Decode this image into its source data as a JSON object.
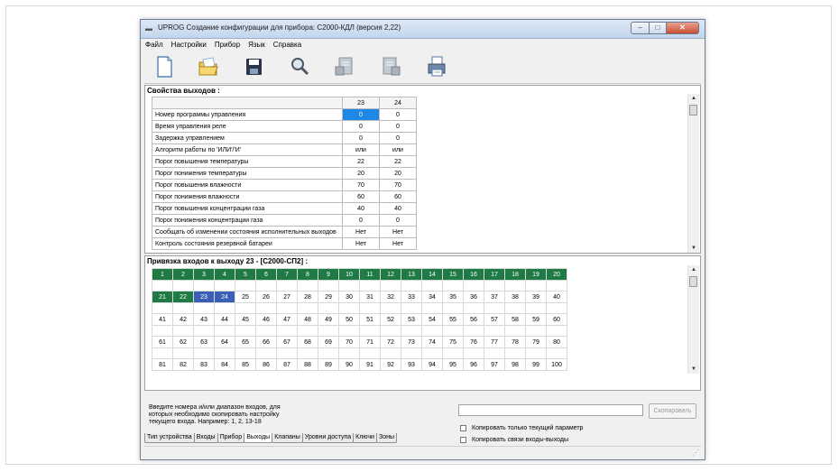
{
  "window": {
    "title": "UPROG  Создание конфигурации для прибора: С2000-КДЛ (версия  2,22)",
    "controls": {
      "minimize": "–",
      "maximize": "□",
      "close": "✕"
    }
  },
  "menu": [
    "Файл",
    "Настройки",
    "Прибор",
    "Язык",
    "Справка"
  ],
  "toolbar": {
    "buttons": [
      "new-file-icon",
      "open-folder-icon",
      "save-icon",
      "search-icon",
      "read-device-icon",
      "write-device-icon",
      "print-icon"
    ]
  },
  "outputs": {
    "header": "Свойства выходов :",
    "columns": [
      "23",
      "24"
    ],
    "rows": [
      {
        "name": "Номер программы управления",
        "v23": "0",
        "v24": "0"
      },
      {
        "name": "Время управления реле",
        "v23": "0",
        "v24": "0"
      },
      {
        "name": "Задержка управлением",
        "v23": "0",
        "v24": "0"
      },
      {
        "name": "Алгоритм работы по 'ИЛИ'/'И'",
        "v23": "или",
        "v24": "или"
      },
      {
        "name": "Порог повышения температуры",
        "v23": "22",
        "v24": "22"
      },
      {
        "name": "Порог понижения температуры",
        "v23": "20",
        "v24": "20"
      },
      {
        "name": "Порог повышения влажности",
        "v23": "70",
        "v24": "70"
      },
      {
        "name": "Порог понижения влажности",
        "v23": "60",
        "v24": "60"
      },
      {
        "name": "Порог повышения концентрации газа",
        "v23": "40",
        "v24": "40"
      },
      {
        "name": "Порог понижения концентрации газа",
        "v23": "0",
        "v24": "0"
      },
      {
        "name": "Сообщать об изменении состояния исполнительных выходов",
        "v23": "Нет",
        "v24": "Нет"
      },
      {
        "name": "Контроль состояния резервной батареи",
        "v23": "Нет",
        "v24": "Нет"
      }
    ]
  },
  "bindings": {
    "header": "Привязка входов к выходу 23 - [С2000-СП2] :",
    "rows": [
      [
        "1",
        "2",
        "3",
        "4",
        "5",
        "6",
        "7",
        "8",
        "9",
        "10",
        "11",
        "12",
        "13",
        "14",
        "15",
        "16",
        "17",
        "18",
        "19",
        "20"
      ],
      [
        "21",
        "22",
        "23",
        "24",
        "25",
        "26",
        "27",
        "28",
        "29",
        "30",
        "31",
        "32",
        "33",
        "34",
        "35",
        "36",
        "37",
        "38",
        "39",
        "40"
      ],
      [
        "41",
        "42",
        "43",
        "44",
        "45",
        "46",
        "47",
        "48",
        "49",
        "50",
        "51",
        "52",
        "53",
        "54",
        "55",
        "56",
        "57",
        "58",
        "59",
        "60"
      ],
      [
        "61",
        "62",
        "63",
        "64",
        "65",
        "66",
        "67",
        "68",
        "69",
        "70",
        "71",
        "72",
        "73",
        "74",
        "75",
        "76",
        "77",
        "78",
        "79",
        "80"
      ],
      [
        "81",
        "82",
        "83",
        "84",
        "85",
        "86",
        "87",
        "88",
        "89",
        "90",
        "91",
        "92",
        "93",
        "94",
        "95",
        "96",
        "97",
        "98",
        "99",
        "100"
      ]
    ],
    "highlight_green": [
      "1",
      "2",
      "3",
      "4",
      "5",
      "6",
      "7",
      "8",
      "9",
      "10",
      "11",
      "12",
      "13",
      "14",
      "15",
      "16",
      "17",
      "18",
      "19",
      "20",
      "21",
      "22"
    ],
    "highlight_blue": [
      "23",
      "24"
    ],
    "colors": {
      "linked": "#1f7a46",
      "selected": "#3a5fb5"
    }
  },
  "copy": {
    "hint": "Введите номера и/или диапазон входов, для которых необходимо скопировать настройку текущего входа. Например: 1, 2, 13-18",
    "input_value": "",
    "button": "Скопировать",
    "only_current": "Копировать только текущий параметр",
    "links": "Копировать связи входы-выходы"
  },
  "tabs": [
    "Тип устройства",
    "Входы",
    "Прибор",
    "Выходы",
    "Клапаны",
    "Уровни доступа",
    "Ключи",
    "Зоны"
  ],
  "active_tab": "Выходы",
  "colors": {
    "selected_cell": "#1e88e5"
  }
}
